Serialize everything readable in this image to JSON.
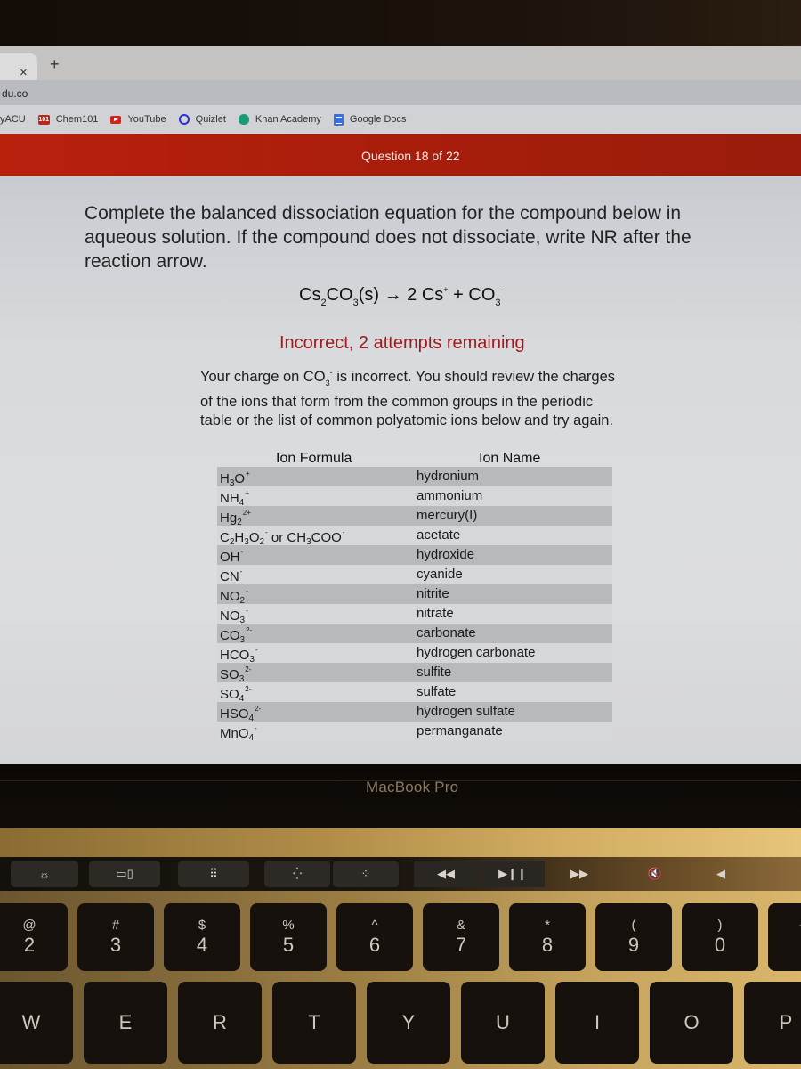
{
  "browser": {
    "tab_close_icon": "×",
    "new_tab_icon": "+",
    "address": "du.co",
    "bookmarks": [
      {
        "label": "yACU",
        "icon": "none"
      },
      {
        "label": "Chem101",
        "icon": "chem101-icon"
      },
      {
        "label": "YouTube",
        "icon": "youtube-icon"
      },
      {
        "label": "Quizlet",
        "icon": "quizlet-icon"
      },
      {
        "label": "Khan Academy",
        "icon": "khan-academy-icon"
      },
      {
        "label": "Google Docs",
        "icon": "google-docs-icon"
      }
    ],
    "chem101_icon_text": "101"
  },
  "header": {
    "question_progress": "Question 18 of 22",
    "accent_color": "#b01f0c"
  },
  "question": {
    "prompt": "Complete the balanced dissociation equation for the compound below in aqueous solution. If the compound does not dissociate, write NR after the reaction arrow.",
    "equation": {
      "reactant": "Cs",
      "reactant_sub1": "2",
      "reactant_mid": "CO",
      "reactant_sub2": "3",
      "reactant_state": "(s)",
      "arrow": "→",
      "coef": "2",
      "cation": "Cs",
      "cation_charge": "+",
      "plus": "+",
      "anion": "CO",
      "anion_sub": "3",
      "anion_charge": "-"
    }
  },
  "feedback": {
    "title": "Incorrect, 2 attempts remaining",
    "title_color": "#9c1a1a",
    "body_pre": "Your charge on CO",
    "body_sub": "3",
    "body_sup": "-",
    "body_post": " is incorrect. You should review the charges of the ions that form from the common groups in the periodic table or the list of common polyatomic ions below and try again."
  },
  "ion_table": {
    "headers": {
      "formula": "Ion Formula",
      "name": "Ion Name"
    },
    "rows": [
      {
        "formula": [
          [
            "H",
            ""
          ],
          [
            "3",
            "sub"
          ],
          [
            "O",
            ""
          ],
          [
            "+",
            "sup"
          ]
        ],
        "name": "hydronium"
      },
      {
        "formula": [
          [
            "NH",
            ""
          ],
          [
            "4",
            "sub"
          ],
          [
            "+",
            "sup"
          ]
        ],
        "name": "ammonium"
      },
      {
        "formula": [
          [
            "Hg",
            ""
          ],
          [
            "2",
            "sub"
          ],
          [
            "2+",
            "sup"
          ]
        ],
        "name": "mercury(I)"
      },
      {
        "formula": [
          [
            "C",
            ""
          ],
          [
            "2",
            "sub"
          ],
          [
            "H",
            ""
          ],
          [
            "3",
            "sub"
          ],
          [
            "O",
            ""
          ],
          [
            "2",
            "sub"
          ],
          [
            "-",
            "sup"
          ],
          [
            " or CH",
            ""
          ],
          [
            "3",
            "sub"
          ],
          [
            "COO",
            ""
          ],
          [
            "-",
            "sup"
          ]
        ],
        "name": "acetate"
      },
      {
        "formula": [
          [
            "OH",
            ""
          ],
          [
            "-",
            "sup"
          ]
        ],
        "name": "hydroxide"
      },
      {
        "formula": [
          [
            "CN",
            ""
          ],
          [
            "-",
            "sup"
          ]
        ],
        "name": "cyanide"
      },
      {
        "formula": [
          [
            "NO",
            ""
          ],
          [
            "2",
            "sub"
          ],
          [
            "-",
            "sup"
          ]
        ],
        "name": "nitrite"
      },
      {
        "formula": [
          [
            "NO",
            ""
          ],
          [
            "3",
            "sub"
          ],
          [
            "-",
            "sup"
          ]
        ],
        "name": "nitrate"
      },
      {
        "formula": [
          [
            "CO",
            ""
          ],
          [
            "3",
            "sub"
          ],
          [
            "2-",
            "sup"
          ]
        ],
        "name": "carbonate"
      },
      {
        "formula": [
          [
            "HCO",
            ""
          ],
          [
            "3",
            "sub"
          ],
          [
            "-",
            "sup"
          ]
        ],
        "name": "hydrogen carbonate"
      },
      {
        "formula": [
          [
            "SO",
            ""
          ],
          [
            "3",
            "sub"
          ],
          [
            "2-",
            "sup"
          ]
        ],
        "name": "sulfite"
      },
      {
        "formula": [
          [
            "SO",
            ""
          ],
          [
            "4",
            "sub"
          ],
          [
            "2-",
            "sup"
          ]
        ],
        "name": "sulfate"
      },
      {
        "formula": [
          [
            "HSO",
            ""
          ],
          [
            "4",
            "sub"
          ],
          [
            "2-",
            "sup"
          ]
        ],
        "name": "hydrogen sulfate"
      },
      {
        "formula": [
          [
            "MnO",
            ""
          ],
          [
            "4",
            "sub"
          ],
          [
            "-",
            "sup"
          ]
        ],
        "name": "permanganate"
      }
    ]
  },
  "laptop": {
    "brand": "MacBook Pro",
    "touchbar": [
      {
        "name": "brightness-icon",
        "glyph": "☼"
      },
      {
        "name": "mission-control-icon",
        "glyph": "▭▯"
      },
      {
        "name": "launchpad-icon",
        "glyph": "⠿"
      },
      {
        "name": "keyboard-brightness-down-icon",
        "glyph": "⁛"
      },
      {
        "name": "keyboard-brightness-up-icon",
        "glyph": "⁘"
      },
      {
        "name": "rewind-icon",
        "glyph": "◀◀"
      },
      {
        "name": "play-pause-icon",
        "glyph": "▶❙❙"
      },
      {
        "name": "fast-forward-icon",
        "glyph": "▶▶"
      },
      {
        "name": "mute-icon",
        "glyph": "🔇"
      },
      {
        "name": "volume-down-icon",
        "glyph": "◀"
      }
    ],
    "number_keys": [
      {
        "top": "@",
        "bot": "2"
      },
      {
        "top": "#",
        "bot": "3"
      },
      {
        "top": "$",
        "bot": "4"
      },
      {
        "top": "%",
        "bot": "5"
      },
      {
        "top": "^",
        "bot": "6"
      },
      {
        "top": "&",
        "bot": "7"
      },
      {
        "top": "*",
        "bot": "8"
      },
      {
        "top": "(",
        "bot": "9"
      },
      {
        "top": ")",
        "bot": "0"
      },
      {
        "top": "—",
        "bot": "-"
      }
    ],
    "letter_keys": [
      "W",
      "E",
      "R",
      "T",
      "Y",
      "U",
      "I",
      "O",
      "P"
    ]
  }
}
